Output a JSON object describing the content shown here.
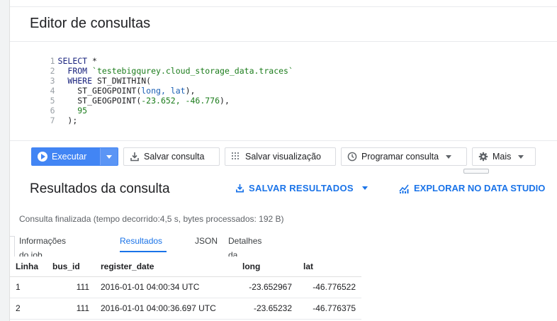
{
  "editor": {
    "title": "Editor de consultas",
    "lines": [
      {
        "n": "1",
        "t1": "SELECT",
        "t2": " *"
      },
      {
        "n": "2",
        "t1": "  FROM",
        "t2": " `testebigqurey.cloud_storage_data.traces`"
      },
      {
        "n": "3",
        "t1": "  WHERE",
        "t2": " ST_DWITHIN("
      },
      {
        "n": "4",
        "t1": "    ST_GEOGPOINT(",
        "t2": "long, lat",
        "t3": "),"
      },
      {
        "n": "5",
        "t1": "    ST_GEOGPOINT(",
        "t2": "-23.652, -46.776",
        "t3": "),"
      },
      {
        "n": "6",
        "t1": "    ",
        "t2": "95"
      },
      {
        "n": "7",
        "t1": "  );"
      }
    ]
  },
  "toolbar": {
    "run_label": "Executar",
    "save_query_label": "Salvar consulta",
    "save_view_label": "Salvar visualização",
    "schedule_label": "Programar consulta",
    "more_label": "Mais"
  },
  "results": {
    "title": "Resultados da consulta",
    "save_results_label": "SALVAR RESULTADOS",
    "data_studio_label": "EXPLORAR NO DATA STUDIO",
    "status": "Consulta finalizada (tempo decorrido:4,5 s, bytes processados: 192 B)",
    "tabs": [
      {
        "label": "Informações do job"
      },
      {
        "label": "Resultados"
      },
      {
        "label": "JSON"
      },
      {
        "label": "Detalhes da execução"
      }
    ],
    "columns": [
      "Linha",
      "bus_id",
      "register_date",
      "long",
      "lat"
    ],
    "rows": [
      [
        "1",
        "111",
        "2016-01-01 04:00:34 UTC",
        "-23.652967",
        "-46.776522"
      ],
      [
        "2",
        "111",
        "2016-01-01 04:00:36.697 UTC",
        "-23.65232",
        "-46.776375"
      ]
    ]
  },
  "colors": {
    "accent": "#1a73e8",
    "run_button": "#4285f4"
  },
  "icons": {
    "run": "play-circle-icon",
    "save_query": "download-tray-icon",
    "save_view": "grid-dots-icon",
    "schedule": "clock-icon",
    "more": "gear-icon",
    "studio": "chart-icon"
  }
}
